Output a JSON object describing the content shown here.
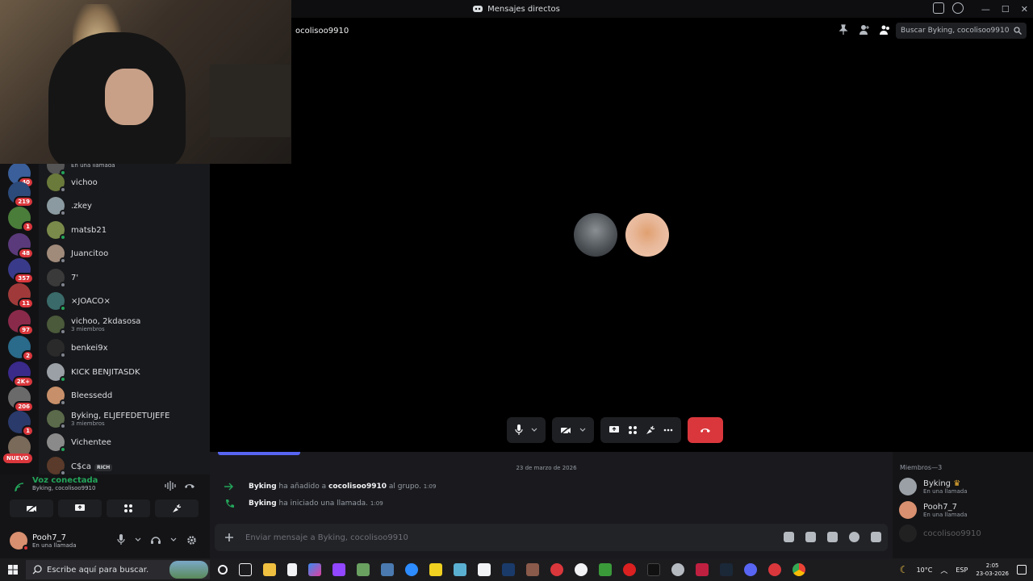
{
  "window": {
    "title": "Mensajes directos"
  },
  "channel": {
    "name": "ocolisoo9910"
  },
  "search": {
    "placeholder": "Buscar Byking, cocolisoo9910"
  },
  "servers": [
    {
      "badge": "40",
      "color": "#3a5f9a"
    },
    {
      "badge": "219",
      "color": "#2c4a7a"
    },
    {
      "badge": "1",
      "color": "#4a7c3a"
    },
    {
      "badge": "48",
      "color": "#5a3a7a"
    },
    {
      "badge": "357",
      "color": "#3a3a8a"
    },
    {
      "badge": "11",
      "color": "#a03a3a"
    },
    {
      "badge": "97",
      "color": "#8a2a4a"
    },
    {
      "badge": "2",
      "color": "#2a6a8a"
    },
    {
      "badge": "2K+",
      "color": "#3a2a8a"
    },
    {
      "badge": "206",
      "color": "#6a6a6a"
    },
    {
      "badge": "1",
      "color": "#2a3a6a"
    },
    {
      "badge": "",
      "color": "#7a6a5a"
    }
  ],
  "nuevo_label": "NUEVO",
  "dms": [
    {
      "name": "En una llamada",
      "sub": "",
      "color": "#555"
    },
    {
      "name": "vichoo",
      "sub": "",
      "color": "#6a7a3a"
    },
    {
      "name": ".zkey",
      "sub": "",
      "color": "#8a9aa0"
    },
    {
      "name": "matsb21",
      "sub": "",
      "color": "#7a8a4a"
    },
    {
      "name": "Juancitoo",
      "sub": "",
      "color": "#a08a7a"
    },
    {
      "name": "7'",
      "sub": "",
      "color": "#3a3a3a"
    },
    {
      "name": "×JOACO×",
      "sub": "",
      "color": "#3a6a6a"
    },
    {
      "name": "vichoo, 2kdasosa",
      "sub": "3 miembros",
      "color": "#4a5a3a"
    },
    {
      "name": "benkei9x",
      "sub": "",
      "color": "#2a2a2a"
    },
    {
      "name": "KICK BENJITASDK",
      "sub": "",
      "color": "#9aa0a6"
    },
    {
      "name": "Bleessedd",
      "sub": "",
      "color": "#c8906a"
    },
    {
      "name": "Byking, ELJEFEDETUJEFE",
      "sub": "3 miembros",
      "color": "#5a6a4a"
    },
    {
      "name": "Vichentee",
      "sub": "",
      "color": "#8a8a8a"
    },
    {
      "name": "C$ca",
      "sub": "",
      "color": "#5a3a2a",
      "tag": "RICH"
    }
  ],
  "voice": {
    "status": "Voz conectada",
    "sub": "Byking, cocolisoo9910"
  },
  "user": {
    "name": "Pooh7_7",
    "status": "En una llamada"
  },
  "chat": {
    "date": "23 de marzo de 2026",
    "messages": [
      {
        "actor": "Byking",
        "text1": "ha añadido a",
        "target": "cocolisoo9910",
        "text2": "al grupo.",
        "time": "1:09"
      },
      {
        "actor": "Byking",
        "text1": "ha iniciado una llamada.",
        "target": "",
        "text2": "",
        "time": "1:09"
      }
    ],
    "placeholder": "Enviar mensaje a Byking, cocolisoo9910"
  },
  "members": {
    "header": "Miembros—3",
    "list": [
      {
        "name": "Byking",
        "sub": "En una llamada",
        "color": "#9aa0a6"
      },
      {
        "name": "Pooh7_7",
        "sub": "En una llamada",
        "color": "#d89070"
      },
      {
        "name": "cocolisoo9910",
        "sub": "",
        "color": "#3a3a3a"
      }
    ]
  },
  "taskbar": {
    "search_placeholder": "Escribe aquí para buscar.",
    "weather": "10°C",
    "lang": "ESP",
    "time": "2:05",
    "date": "23-03-2026"
  }
}
